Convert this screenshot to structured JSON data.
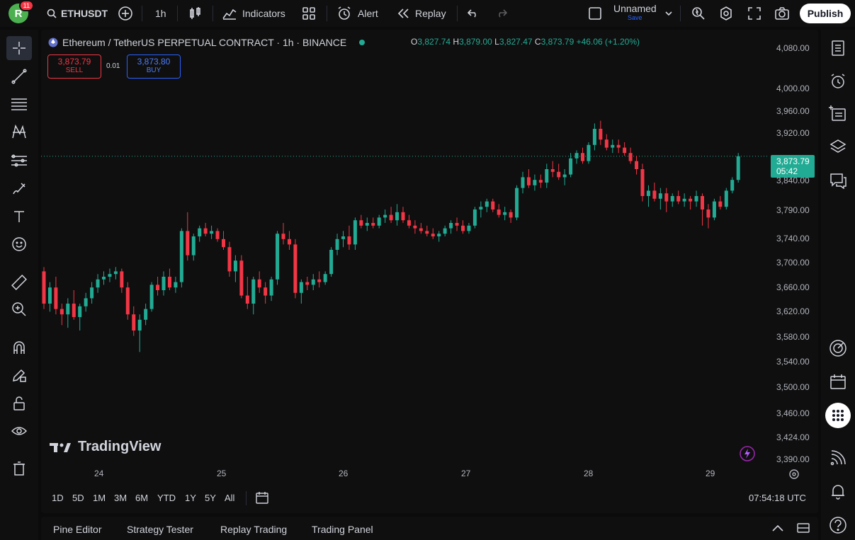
{
  "topbar": {
    "avatar_letter": "R",
    "notifications": "11",
    "symbol": "ETHUSDT",
    "interval": "1h",
    "indicators_label": "Indicators",
    "alert_label": "Alert",
    "replay_label": "Replay",
    "layout_name": "Unnamed",
    "layout_sub": "Save",
    "publish_label": "Publish"
  },
  "legend": {
    "title": "Ethereum / TetherUS PERPETUAL CONTRACT · 1h · BINANCE",
    "o_label": "O",
    "o_value": "3,827.74",
    "h_label": "H",
    "h_value": "3,879.00",
    "l_label": "L",
    "l_value": "3,827.47",
    "c_label": "C",
    "c_value": "3,873.79",
    "change": "+46.06 (+1.20%)"
  },
  "trade": {
    "sell_price": "3,873.79",
    "sell_label": "SELL",
    "spread": "0.01",
    "buy_price": "3,873.80",
    "buy_label": "BUY"
  },
  "price_tag": {
    "price": "3,873.79",
    "countdown": "05:42"
  },
  "yaxis": [
    "4,080.00",
    "4,000.00",
    "3,960.00",
    "3,920.00",
    "3,840.00",
    "3,790.00",
    "3,740.00",
    "3,700.00",
    "3,660.00",
    "3,620.00",
    "3,580.00",
    "3,540.00",
    "3,500.00",
    "3,460.00",
    "3,424.00",
    "3,390.00"
  ],
  "xaxis": [
    "24",
    "25",
    "26",
    "27",
    "28",
    "29"
  ],
  "watermark": "TradingView",
  "ranges": [
    "1D",
    "5D",
    "1M",
    "3M",
    "6M",
    "YTD",
    "1Y",
    "5Y",
    "All"
  ],
  "clock": "07:54:18 UTC",
  "bottom_tabs": [
    "Pine Editor",
    "Strategy Tester",
    "Replay Trading",
    "Trading Panel"
  ],
  "colors": {
    "up": "#22ab94",
    "down": "#f23645",
    "bg": "#0f0f0f"
  },
  "chart_data": {
    "type": "candlestick",
    "symbol": "ETHUSDT",
    "interval": "1h",
    "ylim": [
      3380,
      4090
    ],
    "x_days": [
      "24",
      "25",
      "26",
      "27",
      "28",
      "29"
    ],
    "candles": [
      {
        "o": 3660,
        "h": 3668,
        "l": 3590,
        "c": 3600
      },
      {
        "o": 3600,
        "h": 3640,
        "l": 3585,
        "c": 3630
      },
      {
        "o": 3630,
        "h": 3650,
        "l": 3580,
        "c": 3590
      },
      {
        "o": 3590,
        "h": 3600,
        "l": 3560,
        "c": 3580
      },
      {
        "o": 3580,
        "h": 3610,
        "l": 3555,
        "c": 3600
      },
      {
        "o": 3600,
        "h": 3625,
        "l": 3570,
        "c": 3575
      },
      {
        "o": 3575,
        "h": 3600,
        "l": 3550,
        "c": 3595
      },
      {
        "o": 3595,
        "h": 3620,
        "l": 3585,
        "c": 3610
      },
      {
        "o": 3610,
        "h": 3640,
        "l": 3600,
        "c": 3630
      },
      {
        "o": 3630,
        "h": 3655,
        "l": 3620,
        "c": 3645
      },
      {
        "o": 3645,
        "h": 3660,
        "l": 3635,
        "c": 3650
      },
      {
        "o": 3650,
        "h": 3665,
        "l": 3640,
        "c": 3655
      },
      {
        "o": 3655,
        "h": 3668,
        "l": 3645,
        "c": 3660
      },
      {
        "o": 3660,
        "h": 3665,
        "l": 3620,
        "c": 3630
      },
      {
        "o": 3630,
        "h": 3640,
        "l": 3570,
        "c": 3580
      },
      {
        "o": 3580,
        "h": 3595,
        "l": 3540,
        "c": 3550
      },
      {
        "o": 3550,
        "h": 3580,
        "l": 3510,
        "c": 3570
      },
      {
        "o": 3570,
        "h": 3600,
        "l": 3560,
        "c": 3590
      },
      {
        "o": 3590,
        "h": 3640,
        "l": 3585,
        "c": 3635
      },
      {
        "o": 3635,
        "h": 3650,
        "l": 3615,
        "c": 3625
      },
      {
        "o": 3625,
        "h": 3660,
        "l": 3615,
        "c": 3650
      },
      {
        "o": 3650,
        "h": 3665,
        "l": 3625,
        "c": 3630
      },
      {
        "o": 3630,
        "h": 3650,
        "l": 3620,
        "c": 3640
      },
      {
        "o": 3640,
        "h": 3740,
        "l": 3630,
        "c": 3735
      },
      {
        "o": 3735,
        "h": 3770,
        "l": 3680,
        "c": 3690
      },
      {
        "o": 3690,
        "h": 3730,
        "l": 3680,
        "c": 3725
      },
      {
        "o": 3725,
        "h": 3745,
        "l": 3715,
        "c": 3740
      },
      {
        "o": 3740,
        "h": 3750,
        "l": 3725,
        "c": 3730
      },
      {
        "o": 3730,
        "h": 3745,
        "l": 3720,
        "c": 3735
      },
      {
        "o": 3735,
        "h": 3740,
        "l": 3715,
        "c": 3720
      },
      {
        "o": 3720,
        "h": 3735,
        "l": 3700,
        "c": 3705
      },
      {
        "o": 3705,
        "h": 3715,
        "l": 3650,
        "c": 3660
      },
      {
        "o": 3660,
        "h": 3690,
        "l": 3640,
        "c": 3680
      },
      {
        "o": 3680,
        "h": 3690,
        "l": 3610,
        "c": 3615
      },
      {
        "o": 3615,
        "h": 3650,
        "l": 3590,
        "c": 3600
      },
      {
        "o": 3600,
        "h": 3650,
        "l": 3580,
        "c": 3645
      },
      {
        "o": 3645,
        "h": 3660,
        "l": 3620,
        "c": 3630
      },
      {
        "o": 3630,
        "h": 3640,
        "l": 3600,
        "c": 3615
      },
      {
        "o": 3615,
        "h": 3650,
        "l": 3605,
        "c": 3645
      },
      {
        "o": 3645,
        "h": 3735,
        "l": 3635,
        "c": 3730
      },
      {
        "o": 3730,
        "h": 3750,
        "l": 3710,
        "c": 3720
      },
      {
        "o": 3720,
        "h": 3735,
        "l": 3700,
        "c": 3710
      },
      {
        "o": 3710,
        "h": 3720,
        "l": 3610,
        "c": 3620
      },
      {
        "o": 3620,
        "h": 3645,
        "l": 3600,
        "c": 3640
      },
      {
        "o": 3640,
        "h": 3650,
        "l": 3625,
        "c": 3635
      },
      {
        "o": 3635,
        "h": 3655,
        "l": 3625,
        "c": 3645
      },
      {
        "o": 3645,
        "h": 3660,
        "l": 3630,
        "c": 3640
      },
      {
        "o": 3640,
        "h": 3660,
        "l": 3635,
        "c": 3655
      },
      {
        "o": 3655,
        "h": 3705,
        "l": 3650,
        "c": 3700
      },
      {
        "o": 3700,
        "h": 3730,
        "l": 3690,
        "c": 3720
      },
      {
        "o": 3720,
        "h": 3735,
        "l": 3705,
        "c": 3725
      },
      {
        "o": 3725,
        "h": 3745,
        "l": 3700,
        "c": 3710
      },
      {
        "o": 3710,
        "h": 3760,
        "l": 3700,
        "c": 3755
      },
      {
        "o": 3755,
        "h": 3765,
        "l": 3740,
        "c": 3745
      },
      {
        "o": 3745,
        "h": 3760,
        "l": 3735,
        "c": 3750
      },
      {
        "o": 3750,
        "h": 3760,
        "l": 3740,
        "c": 3745
      },
      {
        "o": 3745,
        "h": 3765,
        "l": 3740,
        "c": 3760
      },
      {
        "o": 3760,
        "h": 3775,
        "l": 3750,
        "c": 3765
      },
      {
        "o": 3765,
        "h": 3780,
        "l": 3750,
        "c": 3755
      },
      {
        "o": 3755,
        "h": 3785,
        "l": 3745,
        "c": 3770
      },
      {
        "o": 3770,
        "h": 3780,
        "l": 3750,
        "c": 3755
      },
      {
        "o": 3755,
        "h": 3765,
        "l": 3740,
        "c": 3745
      },
      {
        "o": 3745,
        "h": 3755,
        "l": 3730,
        "c": 3740
      },
      {
        "o": 3740,
        "h": 3750,
        "l": 3730,
        "c": 3735
      },
      {
        "o": 3735,
        "h": 3745,
        "l": 3725,
        "c": 3730
      },
      {
        "o": 3730,
        "h": 3740,
        "l": 3720,
        "c": 3725
      },
      {
        "o": 3725,
        "h": 3735,
        "l": 3715,
        "c": 3730
      },
      {
        "o": 3730,
        "h": 3745,
        "l": 3725,
        "c": 3740
      },
      {
        "o": 3740,
        "h": 3755,
        "l": 3730,
        "c": 3750
      },
      {
        "o": 3750,
        "h": 3760,
        "l": 3735,
        "c": 3745
      },
      {
        "o": 3745,
        "h": 3755,
        "l": 3730,
        "c": 3735
      },
      {
        "o": 3735,
        "h": 3750,
        "l": 3730,
        "c": 3745
      },
      {
        "o": 3745,
        "h": 3780,
        "l": 3740,
        "c": 3775
      },
      {
        "o": 3775,
        "h": 3790,
        "l": 3760,
        "c": 3780
      },
      {
        "o": 3780,
        "h": 3795,
        "l": 3770,
        "c": 3790
      },
      {
        "o": 3790,
        "h": 3795,
        "l": 3770,
        "c": 3775
      },
      {
        "o": 3775,
        "h": 3785,
        "l": 3760,
        "c": 3765
      },
      {
        "o": 3765,
        "h": 3780,
        "l": 3755,
        "c": 3770
      },
      {
        "o": 3770,
        "h": 3775,
        "l": 3750,
        "c": 3760
      },
      {
        "o": 3760,
        "h": 3820,
        "l": 3755,
        "c": 3815
      },
      {
        "o": 3815,
        "h": 3845,
        "l": 3805,
        "c": 3835
      },
      {
        "o": 3835,
        "h": 3850,
        "l": 3815,
        "c": 3820
      },
      {
        "o": 3820,
        "h": 3840,
        "l": 3810,
        "c": 3830
      },
      {
        "o": 3830,
        "h": 3840,
        "l": 3815,
        "c": 3825
      },
      {
        "o": 3825,
        "h": 3860,
        "l": 3815,
        "c": 3850
      },
      {
        "o": 3850,
        "h": 3865,
        "l": 3835,
        "c": 3845
      },
      {
        "o": 3845,
        "h": 3860,
        "l": 3830,
        "c": 3835
      },
      {
        "o": 3835,
        "h": 3850,
        "l": 3820,
        "c": 3840
      },
      {
        "o": 3840,
        "h": 3880,
        "l": 3835,
        "c": 3870
      },
      {
        "o": 3870,
        "h": 3885,
        "l": 3860,
        "c": 3880
      },
      {
        "o": 3880,
        "h": 3890,
        "l": 3860,
        "c": 3865
      },
      {
        "o": 3865,
        "h": 3900,
        "l": 3860,
        "c": 3895
      },
      {
        "o": 3895,
        "h": 3935,
        "l": 3885,
        "c": 3925
      },
      {
        "o": 3925,
        "h": 3940,
        "l": 3895,
        "c": 3905
      },
      {
        "o": 3905,
        "h": 3915,
        "l": 3885,
        "c": 3890
      },
      {
        "o": 3890,
        "h": 3905,
        "l": 3880,
        "c": 3895
      },
      {
        "o": 3895,
        "h": 3905,
        "l": 3880,
        "c": 3890
      },
      {
        "o": 3890,
        "h": 3900,
        "l": 3875,
        "c": 3880
      },
      {
        "o": 3880,
        "h": 3890,
        "l": 3860,
        "c": 3865
      },
      {
        "o": 3865,
        "h": 3875,
        "l": 3840,
        "c": 3850
      },
      {
        "o": 3850,
        "h": 3860,
        "l": 3790,
        "c": 3800
      },
      {
        "o": 3800,
        "h": 3820,
        "l": 3780,
        "c": 3810
      },
      {
        "o": 3810,
        "h": 3825,
        "l": 3790,
        "c": 3795
      },
      {
        "o": 3795,
        "h": 3815,
        "l": 3775,
        "c": 3805
      },
      {
        "o": 3805,
        "h": 3815,
        "l": 3770,
        "c": 3790
      },
      {
        "o": 3790,
        "h": 3805,
        "l": 3780,
        "c": 3800
      },
      {
        "o": 3800,
        "h": 3810,
        "l": 3785,
        "c": 3790
      },
      {
        "o": 3790,
        "h": 3805,
        "l": 3780,
        "c": 3795
      },
      {
        "o": 3795,
        "h": 3800,
        "l": 3775,
        "c": 3790
      },
      {
        "o": 3790,
        "h": 3810,
        "l": 3780,
        "c": 3800
      },
      {
        "o": 3800,
        "h": 3805,
        "l": 3745,
        "c": 3775
      },
      {
        "o": 3775,
        "h": 3785,
        "l": 3740,
        "c": 3760
      },
      {
        "o": 3760,
        "h": 3795,
        "l": 3755,
        "c": 3790
      },
      {
        "o": 3790,
        "h": 3800,
        "l": 3775,
        "c": 3780
      },
      {
        "o": 3780,
        "h": 3815,
        "l": 3775,
        "c": 3810
      },
      {
        "o": 3810,
        "h": 3835,
        "l": 3805,
        "c": 3830
      },
      {
        "o": 3830,
        "h": 3880,
        "l": 3825,
        "c": 3874
      }
    ]
  }
}
